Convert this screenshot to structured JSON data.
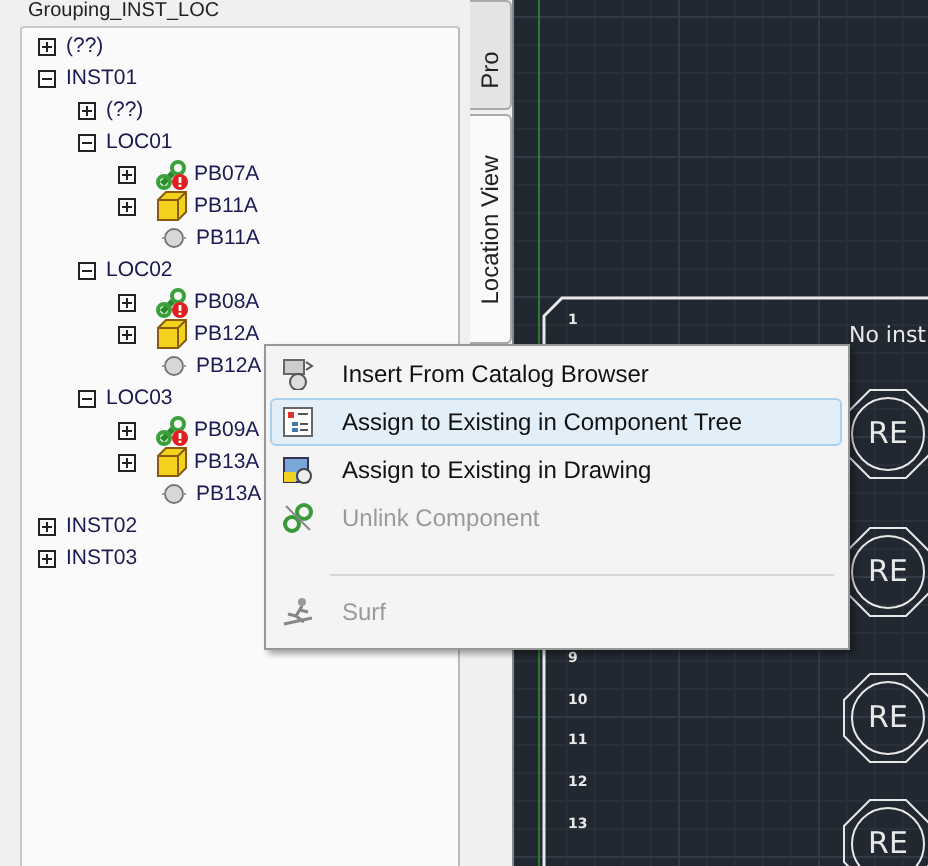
{
  "panel": {
    "title": "Grouping_INST_LOC",
    "tree": [
      {
        "label": "(??)",
        "expanded": false
      },
      {
        "label": "INST01",
        "expanded": true,
        "children": [
          {
            "label": "(??)",
            "expanded": false
          },
          {
            "label": "LOC01",
            "expanded": true,
            "children": [
              {
                "label": "PB07A",
                "expanded": false,
                "kind": "linked"
              },
              {
                "label": "PB11A",
                "expanded": false,
                "kind": "part"
              },
              {
                "label": "PB11A",
                "kind": "point"
              }
            ]
          },
          {
            "label": "LOC02",
            "expanded": true,
            "children": [
              {
                "label": "PB08A",
                "expanded": false,
                "kind": "linked"
              },
              {
                "label": "PB12A",
                "expanded": false,
                "kind": "part"
              },
              {
                "label": "PB12A",
                "kind": "point"
              }
            ]
          },
          {
            "label": "LOC03",
            "expanded": true,
            "children": [
              {
                "label": "PB09A",
                "expanded": false,
                "kind": "linked"
              },
              {
                "label": "PB13A",
                "expanded": false,
                "kind": "part"
              },
              {
                "label": "PB13A",
                "kind": "point"
              }
            ]
          }
        ]
      },
      {
        "label": "INST02",
        "expanded": false
      },
      {
        "label": "INST03",
        "expanded": false
      }
    ]
  },
  "side_tabs": [
    {
      "label": "Pro",
      "selected": false
    },
    {
      "label": "Location View",
      "selected": true
    }
  ],
  "drawing": {
    "heading": "No inst",
    "row_numbers": [
      "1",
      "9",
      "10",
      "11",
      "12",
      "13"
    ],
    "symbols": [
      {
        "label": "RE"
      },
      {
        "label": "RE"
      },
      {
        "label": "RE"
      },
      {
        "label": "RE"
      }
    ]
  },
  "context_menu": {
    "items": [
      {
        "kind": "item",
        "label": "Insert From Catalog Browser",
        "disabled": false,
        "highlighted": false
      },
      {
        "kind": "item",
        "label": "Assign to Existing in Component Tree",
        "disabled": false,
        "highlighted": true
      },
      {
        "kind": "item",
        "label": "Assign to Existing in Drawing",
        "disabled": false,
        "highlighted": false
      },
      {
        "kind": "item",
        "label": "Unlink Component",
        "disabled": true,
        "highlighted": false
      },
      {
        "kind": "separator"
      },
      {
        "kind": "item",
        "label": "Surf",
        "disabled": true,
        "highlighted": false
      }
    ]
  }
}
